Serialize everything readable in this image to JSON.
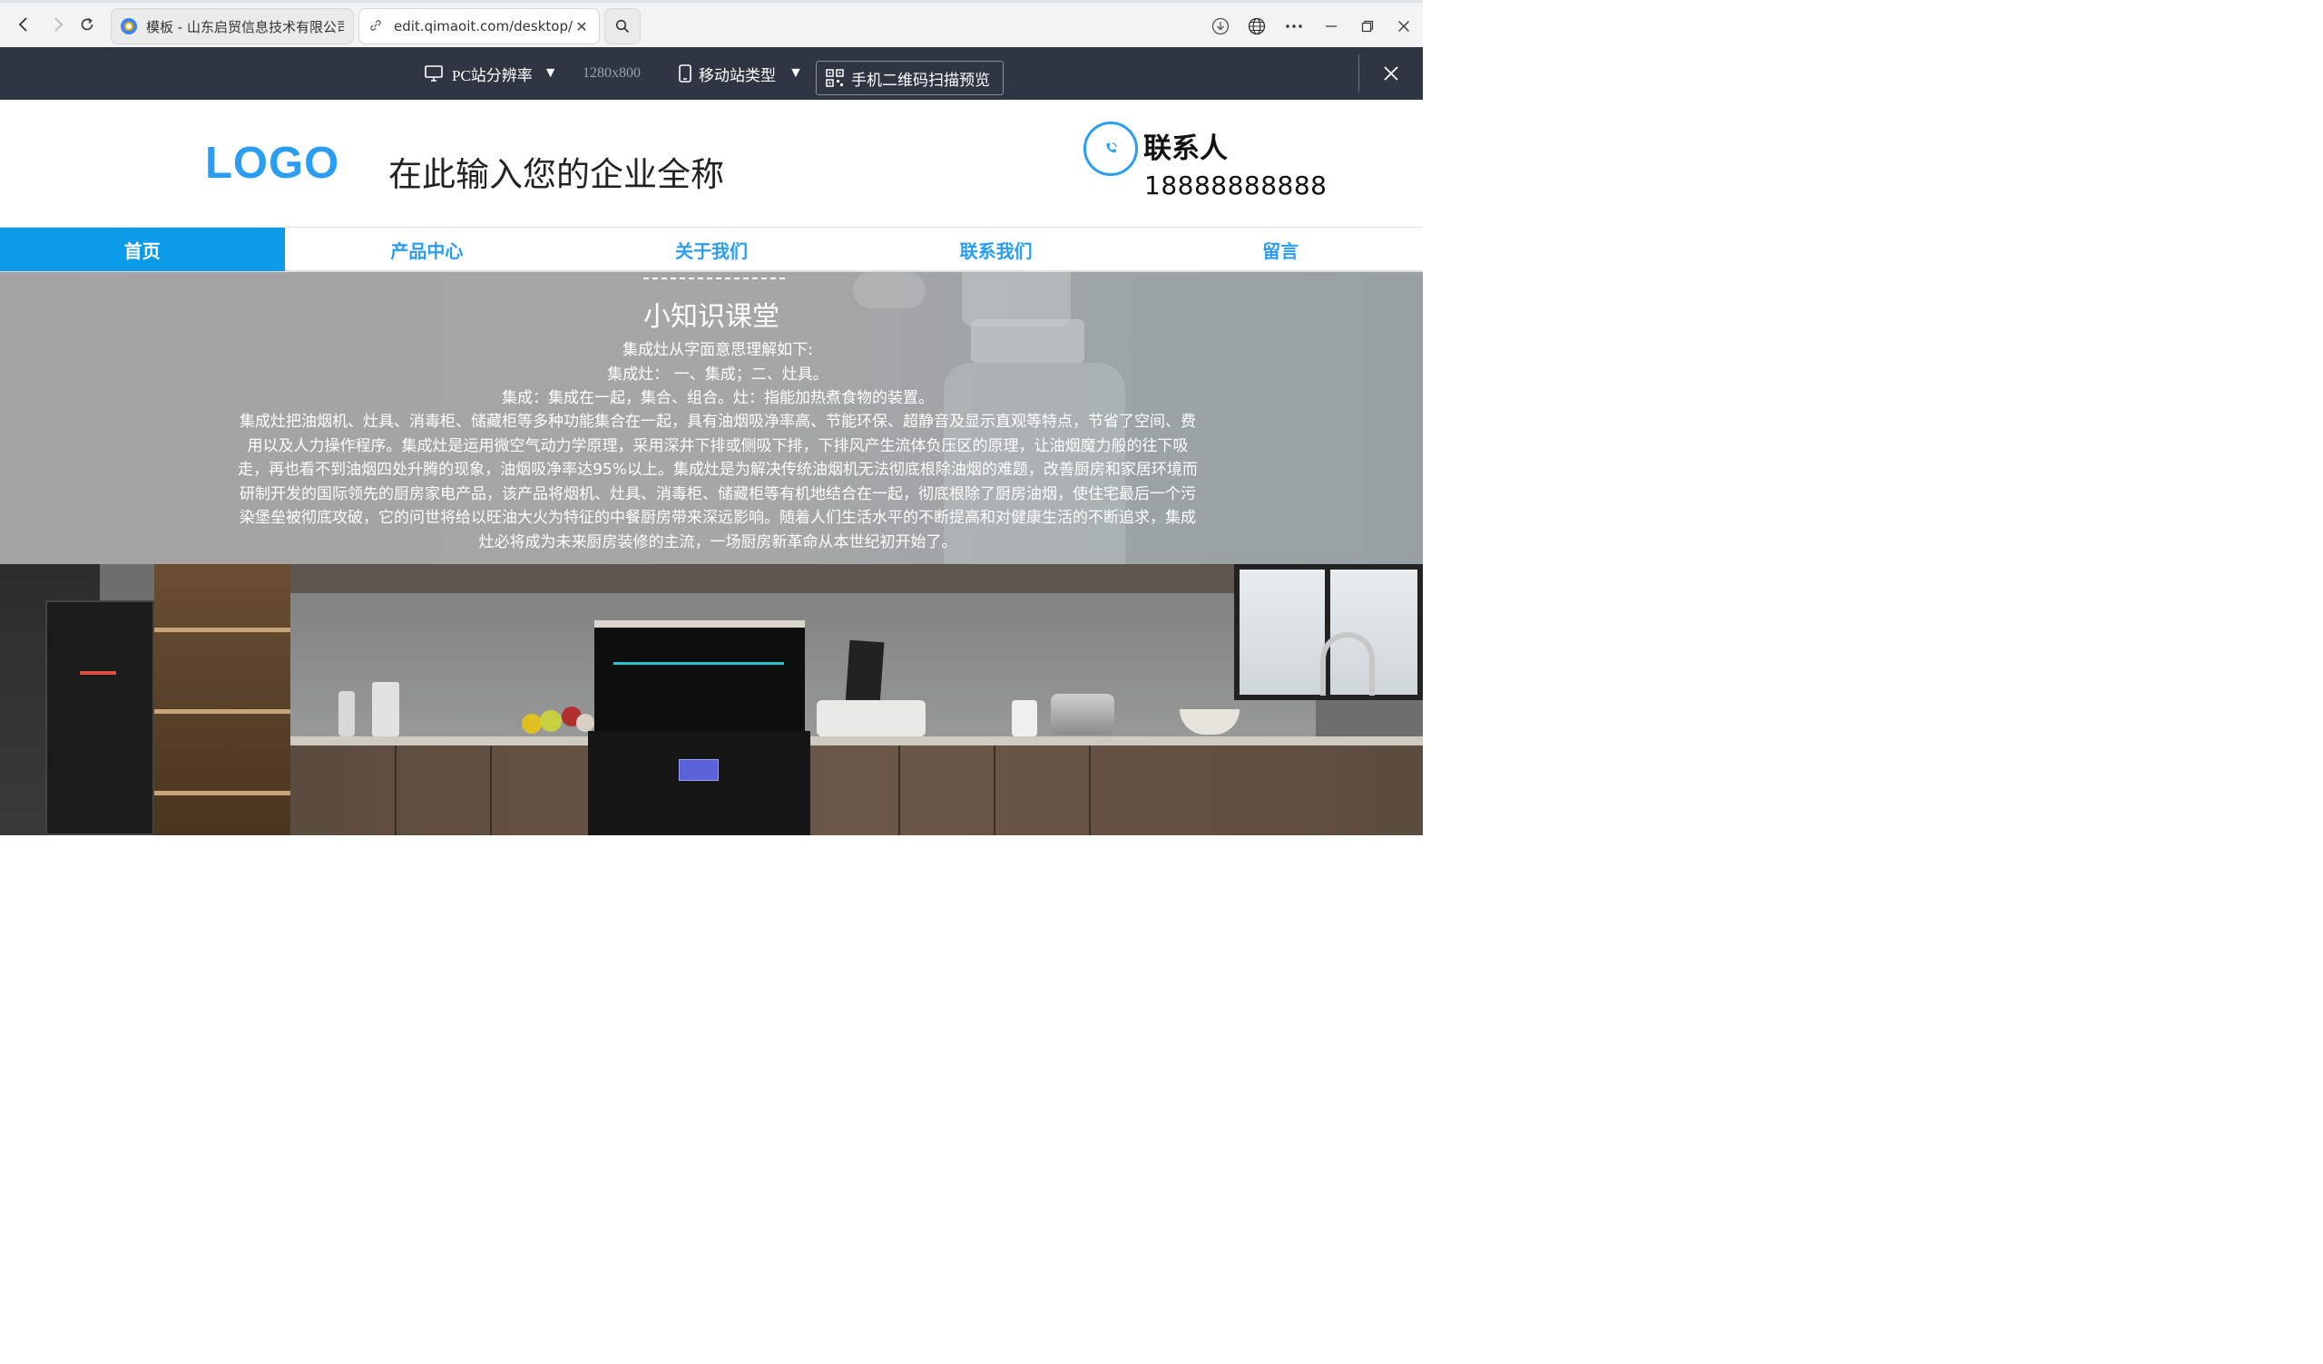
{
  "browser": {
    "tab_inactive_title": "模板 - 山东启贸信息技术有限公司",
    "tab_active_url": "edit.qimaoit.com/desktop/h",
    "tab_close": "✕"
  },
  "preview_toolbar": {
    "pc_resolution_label": "PC站分辨率",
    "dropdown_arrow": "▼",
    "resolution_value": "1280x800",
    "mobile_type_label": "移动站类型",
    "qr_preview_label": "手机二维码扫描预览"
  },
  "site": {
    "logo": "LOGO",
    "company_name": "在此输入您的企业全称",
    "contact_label": "联系人",
    "contact_phone": "18888888888",
    "nav": [
      {
        "label": "首页"
      },
      {
        "label": "产品中心"
      },
      {
        "label": "关于我们"
      },
      {
        "label": "联系我们"
      },
      {
        "label": "留言"
      }
    ],
    "knowledge": {
      "divider": "--------------------",
      "title": "小知识课堂",
      "line1": "集成灶从字面意思理解如下:",
      "line2": "集成灶： 一、集成；二、灶具。",
      "line3": "集成：集成在一起，集合、组合。灶：指能加热煮食物的装置。",
      "paragraph": "集成灶把油烟机、灶具、消毒柜、储藏柜等多种功能集合在一起，具有油烟吸净率高、节能环保、超静音及显示直观等特点，节省了空间、费用以及人力操作程序。集成灶是运用微空气动力学原理，采用深井下排或侧吸下排，下排风产生流体负压区的原理，让油烟魔力般的往下吸走，再也看不到油烟四处升腾的现象，油烟吸净率达95%以上。集成灶是为解决传统油烟机无法彻底根除油烟的难题，改善厨房和家居环境而研制开发的国际领先的厨房家电产品，该产品将烟机、灶具、消毒柜、储藏柜等有机地结合在一起，彻底根除了厨房油烟，使住宅最后一个污染堡垒被彻底攻破，它的问世将给以旺油大火为特征的中餐厨房带来深远影响。随着人们生活水平的不断提高和对健康生活的不断追求，集成灶必将成为未来厨房装修的主流，一场厨房新革命从本世纪初开始了。"
    }
  },
  "colors": {
    "brand_blue": "#2a9df4",
    "nav_active": "#0c9be9",
    "toolbar_bg": "#2f3542"
  },
  "icons": {
    "back": "back-arrow-icon",
    "forward": "forward-arrow-icon",
    "reload": "reload-icon",
    "search": "search-icon",
    "download": "download-icon",
    "globe": "globe-icon",
    "more": "more-icon",
    "monitor": "monitor-icon",
    "mobile": "mobile-phone-icon",
    "qr": "qr-code-icon",
    "phone": "phone-icon"
  }
}
